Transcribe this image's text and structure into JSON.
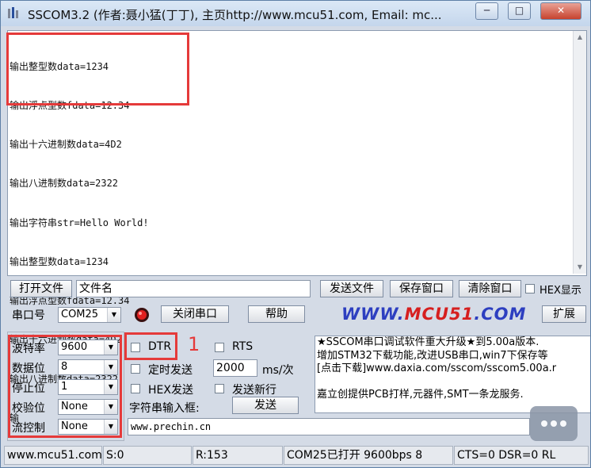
{
  "window": {
    "title": "SSCOM3.2 (作者:聂小猛(丁丁), 主页http://www.mcu51.com,  Email: mc...",
    "controls": {
      "minimize": "─",
      "maximize": "□",
      "close": "✕"
    }
  },
  "receive": {
    "lines": [
      "输出整型数data=1234",
      "输出浮点型数fdata=12.34",
      "输出十六进制数data=4D2",
      "输出八进制数data=2322",
      "输出字符串str=Hello World!",
      "输出整型数data=1234",
      "输出浮点型数fdata=12.34",
      "输出十六进制数data=4D2",
      "输出八进制数data=2322",
      "输"
    ]
  },
  "toolbar": {
    "open_file": "打开文件",
    "filename": "文件名",
    "send_file": "发送文件",
    "save_window": "保存窗口",
    "clear_window": "清除窗口",
    "hex_display": "HEX显示"
  },
  "port_row": {
    "port_label": "串口号",
    "port_value": "COM25",
    "close_port": "关闭串口",
    "help": "帮助",
    "brand_left": "WWW.",
    "brand_mid": "MCU51",
    "brand_right": ".COM",
    "expand": "扩展"
  },
  "settings": {
    "baud_label": "波特率",
    "baud_value": "9600",
    "data_label": "数据位",
    "data_value": "8",
    "stop_label": "停止位",
    "stop_value": "1",
    "parity_label": "校验位",
    "parity_value": "None",
    "flow_label": "流控制",
    "flow_value": "None"
  },
  "send_options": {
    "dtr": "DTR",
    "rts": "RTS",
    "timed_send": "定时发送",
    "interval": "2000",
    "unit": "ms/次",
    "hex_send": "HEX发送",
    "send_newline": "发送新行",
    "input_label": "字符串输入框:",
    "send_button": "发送",
    "input_value": "www.prechin.cn"
  },
  "annotation": "1",
  "info_text": [
    "★SSCOM串口调试软件重大升级★到5.00a版本.",
    "增加STM32下载功能,改进USB串口,win7下保存等",
    "[点击下载]www.daxia.com/sscom/sscom5.00a.r",
    "",
    "嘉立创提供PCB打样,元器件,SMT一条龙服务."
  ],
  "status": {
    "site": "www.mcu51.com",
    "sent": "S:0",
    "received": "R:153",
    "port_state": "COM25已打开  9600bps  8",
    "lines": "CTS=0 DSR=0 RL"
  },
  "colors": {
    "highlight": "#e53a3a",
    "brand_blue": "#2d3fc0",
    "brand_red": "#d61f1f"
  }
}
